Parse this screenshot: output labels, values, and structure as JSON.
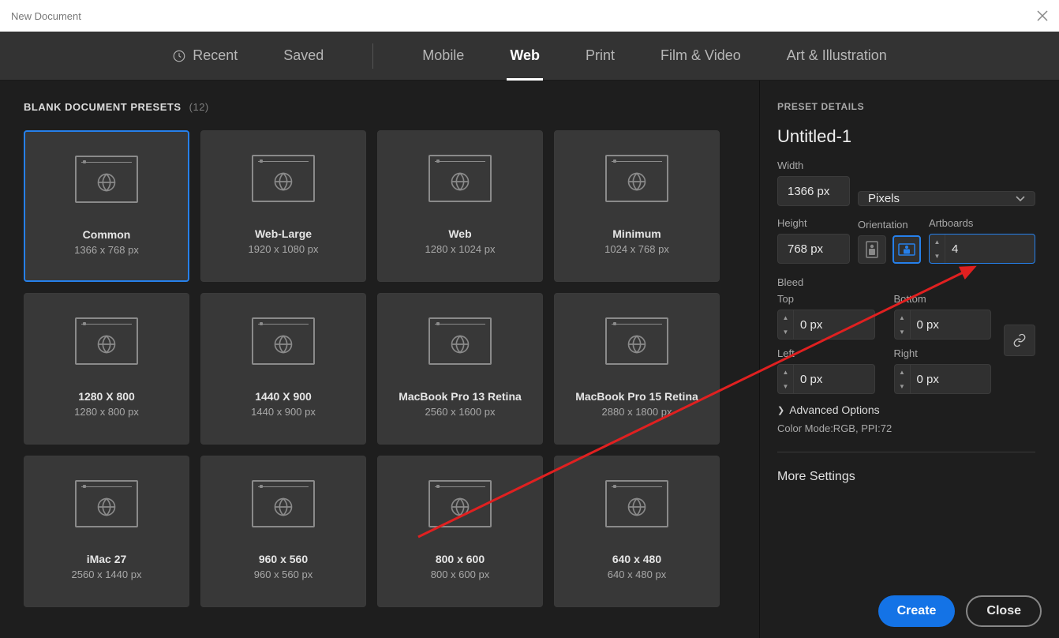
{
  "title_bar": {
    "title": "New Document"
  },
  "tabs": {
    "recent": "Recent",
    "saved": "Saved",
    "mobile": "Mobile",
    "web": "Web",
    "print": "Print",
    "film": "Film & Video",
    "art": "Art & Illustration",
    "active": "Web"
  },
  "presets_header": {
    "label": "BLANK DOCUMENT PRESETS",
    "count": "(12)"
  },
  "presets": [
    {
      "title": "Common",
      "sub": "1366 x 768 px",
      "selected": true
    },
    {
      "title": "Web-Large",
      "sub": "1920 x 1080 px"
    },
    {
      "title": "Web",
      "sub": "1280 x 1024 px"
    },
    {
      "title": "Minimum",
      "sub": "1024 x 768 px"
    },
    {
      "title": "1280 X 800",
      "sub": "1280 x 800 px"
    },
    {
      "title": "1440 X 900",
      "sub": "1440 x 900 px"
    },
    {
      "title": "MacBook Pro 13 Retina",
      "sub": "2560 x 1600 px"
    },
    {
      "title": "MacBook Pro 15 Retina",
      "sub": "2880 x 1800 px"
    },
    {
      "title": "iMac 27",
      "sub": "2560 x 1440 px"
    },
    {
      "title": "960 x 560",
      "sub": "960 x 560 px"
    },
    {
      "title": "800 x 600",
      "sub": "800 x 600 px"
    },
    {
      "title": "640 x 480",
      "sub": "640 x 480 px"
    }
  ],
  "details": {
    "panel_title": "PRESET DETAILS",
    "doc_name": "Untitled-1",
    "width_label": "Width",
    "width_value": "1366 px",
    "units_value": "Pixels",
    "height_label": "Height",
    "height_value": "768 px",
    "orientation_label": "Orientation",
    "artboards_label": "Artboards",
    "artboards_value": "4",
    "bleed_label": "Bleed",
    "bleed_top_label": "Top",
    "bleed_bottom_label": "Bottom",
    "bleed_left_label": "Left",
    "bleed_right_label": "Right",
    "bleed_top": "0 px",
    "bleed_bottom": "0 px",
    "bleed_left": "0 px",
    "bleed_right": "0 px",
    "advanced": "Advanced Options",
    "mode_info": "Color Mode:RGB, PPI:72",
    "more_settings": "More Settings"
  },
  "footer": {
    "create": "Create",
    "close": "Close"
  }
}
